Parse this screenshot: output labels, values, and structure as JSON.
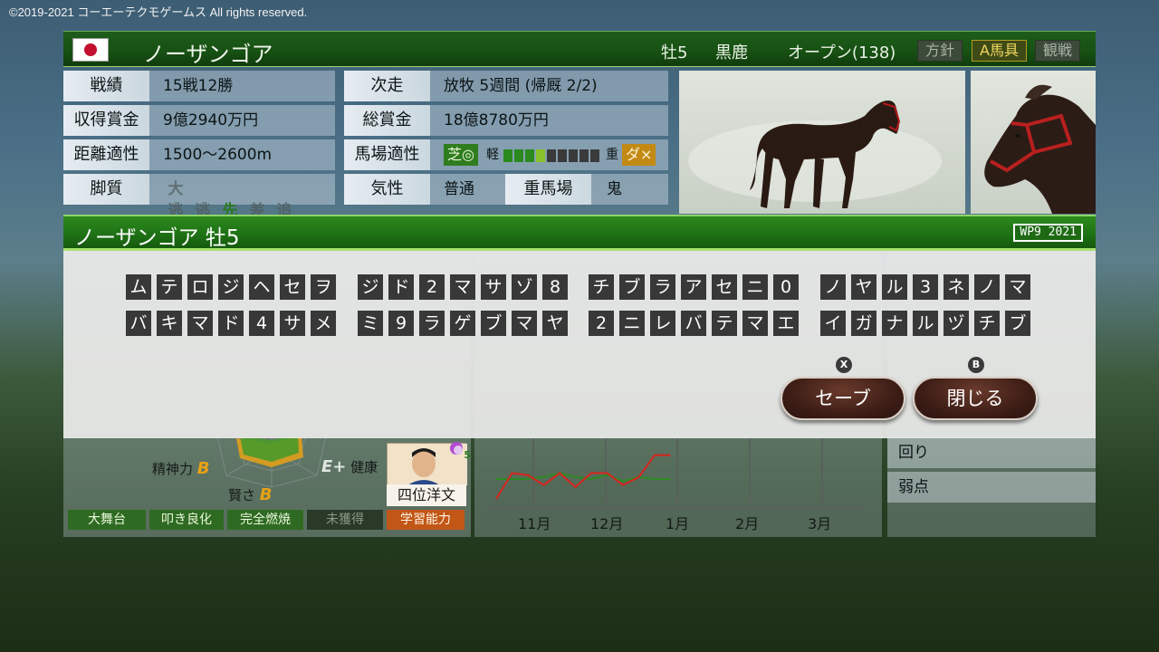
{
  "copyright": "©2019-2021 コーエーテクモゲームス All rights reserved.",
  "header": {
    "horse_name": "ノーザンゴア",
    "sex_age": "牡5",
    "coat": "黒鹿",
    "class": "オープン(138)",
    "buttons": {
      "policy": "方針",
      "gear": "A馬具",
      "watch": "観戦"
    }
  },
  "info": {
    "record_label": "戦績",
    "record_value": "15戦12勝",
    "earnings_label": "収得賞金",
    "earnings_value": "9億2940万円",
    "distance_label": "距離適性",
    "distance_value": "1500〜2600m",
    "legs_label": "脚質",
    "legs": [
      "大逃",
      "逃",
      "先",
      "差",
      "追"
    ],
    "next_label": "次走",
    "next_value": "放牧 5週間 (帰厩 2/2)",
    "total_label": "総賞金",
    "total_value": "18億8780万円",
    "track_label": "馬場適性",
    "turf": "芝◎",
    "light": "軽",
    "heavy": "重",
    "dirt": "ダ×",
    "track_level": 4,
    "temper_label": "気性",
    "temper_value": "普通",
    "heavy_track_label": "重馬場",
    "heavy_track_value": "鬼"
  },
  "dialog": {
    "title": "ノーザンゴア 牡5",
    "version": "WP9 2021",
    "password_rows": [
      [
        "ムテロジヘセヲ",
        "ジド2マサゾ8",
        "チブラアセニ0",
        "ノヤル3ネノマ"
      ],
      [
        "バキマド4サメ",
        "ミ9ラゲブマヤ",
        "2ニレバテマエ",
        "イガナルヅチブ"
      ]
    ],
    "save_hint": "X",
    "save_label": "セーブ",
    "close_hint": "B",
    "close_label": "閉じる"
  },
  "stats": {
    "spirit_label": "精神力",
    "spirit_grade": "B",
    "wisdom_label": "賢さ",
    "wisdom_grade": "B",
    "health_label": "健康",
    "health_grade": "E+",
    "jockey_name": "四位洋文",
    "jockey_badge": "5",
    "chips": [
      "大舞台",
      "叩き良化",
      "完全燃焼",
      "未獲得",
      "学習能力"
    ]
  },
  "chart": {
    "months": [
      "11月",
      "12月",
      "1月",
      "2月",
      "3月"
    ],
    "red_series": [
      2,
      3.3,
      3.2,
      2.7,
      3.3,
      2.6,
      3.3,
      3.3,
      2.7,
      3.1,
      4.2,
      4.2
    ],
    "green_series": [
      3,
      3.0,
      3.0,
      3.1,
      3.3,
      3.1,
      3.0,
      3.2,
      2.9,
      3.1,
      3.0,
      3.0
    ],
    "colors": {
      "red": "#d7251d",
      "green": "#2d8a22"
    }
  },
  "right_panel": {
    "item1": "回り",
    "item2": "弱点"
  }
}
